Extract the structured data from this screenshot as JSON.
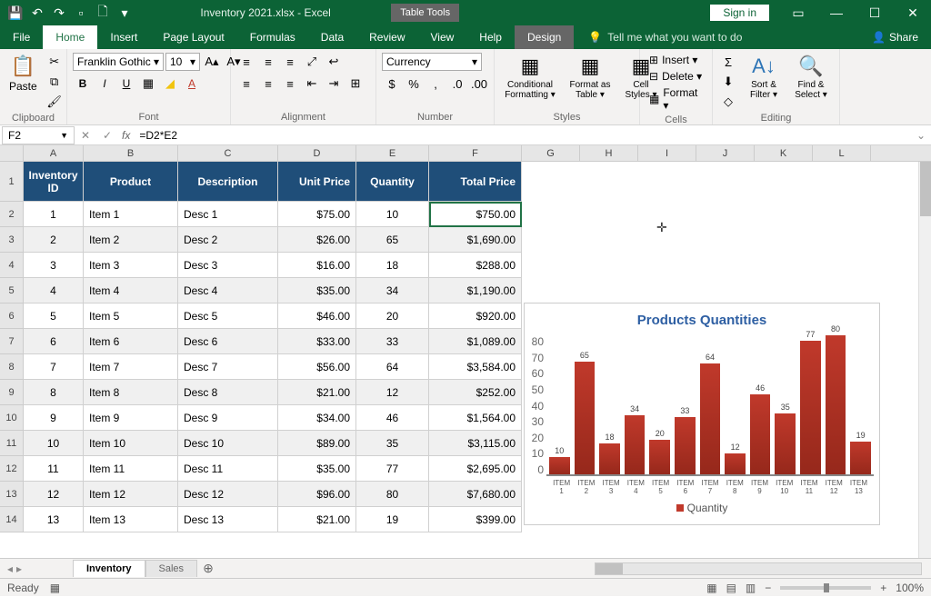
{
  "titlebar": {
    "title": "Inventory 2021.xlsx - Excel",
    "table_tools": "Table Tools",
    "signin": "Sign in"
  },
  "tabs": {
    "file": "File",
    "home": "Home",
    "insert": "Insert",
    "page_layout": "Page Layout",
    "formulas": "Formulas",
    "data": "Data",
    "review": "Review",
    "view": "View",
    "help": "Help",
    "design": "Design",
    "tell": "Tell me what you want to do",
    "share": "Share"
  },
  "ribbon": {
    "clipboard": {
      "paste": "Paste",
      "label": "Clipboard"
    },
    "font": {
      "name": "Franklin Gothic",
      "size": "10",
      "label": "Font"
    },
    "alignment": {
      "label": "Alignment"
    },
    "number": {
      "format": "Currency",
      "label": "Number"
    },
    "styles": {
      "cond": "Conditional Formatting ▾",
      "table": "Format as Table ▾",
      "cell": "Cell Styles ▾",
      "label": "Styles"
    },
    "cells": {
      "insert": "Insert ▾",
      "delete": "Delete ▾",
      "format": "Format ▾",
      "label": "Cells"
    },
    "editing": {
      "sort": "Sort & Filter ▾",
      "find": "Find & Select ▾",
      "label": "Editing"
    }
  },
  "formula_bar": {
    "name_box": "F2",
    "formula": "=D2*E2"
  },
  "columns": [
    "A",
    "B",
    "C",
    "D",
    "E",
    "F",
    "G",
    "H",
    "I",
    "J",
    "K",
    "L"
  ],
  "table": {
    "headers": [
      "Inventory ID",
      "Product",
      "Description",
      "Unit Price",
      "Quantity",
      "Total Price"
    ],
    "rows": [
      {
        "id": "1",
        "product": "Item 1",
        "desc": "Desc 1",
        "price": "$75.00",
        "qty": "10",
        "total": "$750.00"
      },
      {
        "id": "2",
        "product": "Item 2",
        "desc": "Desc 2",
        "price": "$26.00",
        "qty": "65",
        "total": "$1,690.00"
      },
      {
        "id": "3",
        "product": "Item 3",
        "desc": "Desc 3",
        "price": "$16.00",
        "qty": "18",
        "total": "$288.00"
      },
      {
        "id": "4",
        "product": "Item 4",
        "desc": "Desc 4",
        "price": "$35.00",
        "qty": "34",
        "total": "$1,190.00"
      },
      {
        "id": "5",
        "product": "Item 5",
        "desc": "Desc 5",
        "price": "$46.00",
        "qty": "20",
        "total": "$920.00"
      },
      {
        "id": "6",
        "product": "Item 6",
        "desc": "Desc 6",
        "price": "$33.00",
        "qty": "33",
        "total": "$1,089.00"
      },
      {
        "id": "7",
        "product": "Item 7",
        "desc": "Desc 7",
        "price": "$56.00",
        "qty": "64",
        "total": "$3,584.00"
      },
      {
        "id": "8",
        "product": "Item 8",
        "desc": "Desc 8",
        "price": "$21.00",
        "qty": "12",
        "total": "$252.00"
      },
      {
        "id": "9",
        "product": "Item 9",
        "desc": "Desc 9",
        "price": "$34.00",
        "qty": "46",
        "total": "$1,564.00"
      },
      {
        "id": "10",
        "product": "Item 10",
        "desc": "Desc 10",
        "price": "$89.00",
        "qty": "35",
        "total": "$3,115.00"
      },
      {
        "id": "11",
        "product": "Item 11",
        "desc": "Desc 11",
        "price": "$35.00",
        "qty": "77",
        "total": "$2,695.00"
      },
      {
        "id": "12",
        "product": "Item 12",
        "desc": "Desc 12",
        "price": "$96.00",
        "qty": "80",
        "total": "$7,680.00"
      },
      {
        "id": "13",
        "product": "Item 13",
        "desc": "Desc 13",
        "price": "$21.00",
        "qty": "19",
        "total": "$399.00"
      }
    ]
  },
  "chart_data": {
    "type": "bar",
    "title": "Products Quantities",
    "categories": [
      "ITEM 1",
      "ITEM 2",
      "ITEM 3",
      "ITEM 4",
      "ITEM 5",
      "ITEM 6",
      "ITEM 7",
      "ITEM 8",
      "ITEM 9",
      "ITEM 10",
      "ITEM 11",
      "ITEM 12",
      "ITEM 13"
    ],
    "values": [
      10,
      65,
      18,
      34,
      20,
      33,
      64,
      12,
      46,
      35,
      77,
      80,
      19
    ],
    "ylim": [
      0,
      80
    ],
    "yticks": [
      0,
      10,
      20,
      30,
      40,
      50,
      60,
      70,
      80
    ],
    "legend": "Quantity"
  },
  "sheets": {
    "active": "Inventory",
    "other": "Sales"
  },
  "status": {
    "ready": "Ready",
    "zoom": "100%"
  }
}
